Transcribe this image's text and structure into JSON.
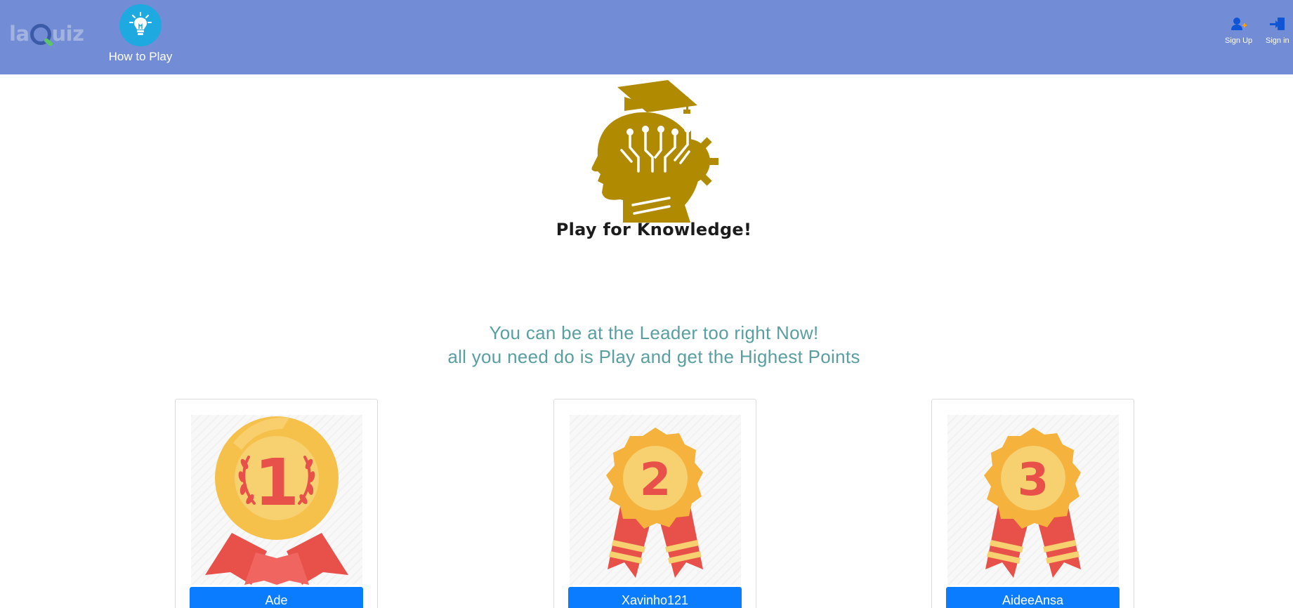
{
  "navbar": {
    "logo_prefix": "la",
    "logo_suffix": "uiz",
    "how_to_play": "How to Play",
    "sign_up": "Sign Up",
    "sign_in": "Sign in"
  },
  "hero": {
    "tagline": "Play for Knowledge!"
  },
  "invite": {
    "line1": "You can be at the Leader too right Now!",
    "line2": "all you need do is Play and get the Highest Points"
  },
  "leaders": [
    {
      "rank": "1",
      "name": "Ade"
    },
    {
      "rank": "2",
      "name": "Xavinho121"
    },
    {
      "rank": "3",
      "name": "AideeAnsa"
    }
  ],
  "colors": {
    "navbar": "#728cd6",
    "how_to_play_circle": "#1fa9e1",
    "illustration": "#b08a00",
    "invite_text": "#5a9fa0",
    "leader_button": "#0a7cff",
    "medal_gold": "#f5c14b",
    "medal_red": "#e8514a"
  },
  "icons": {
    "how_to_play": "lightbulb-icon",
    "sign_up": "user-plus-icon",
    "sign_in": "sign-in-icon",
    "hero": "knowledge-head-icon"
  }
}
